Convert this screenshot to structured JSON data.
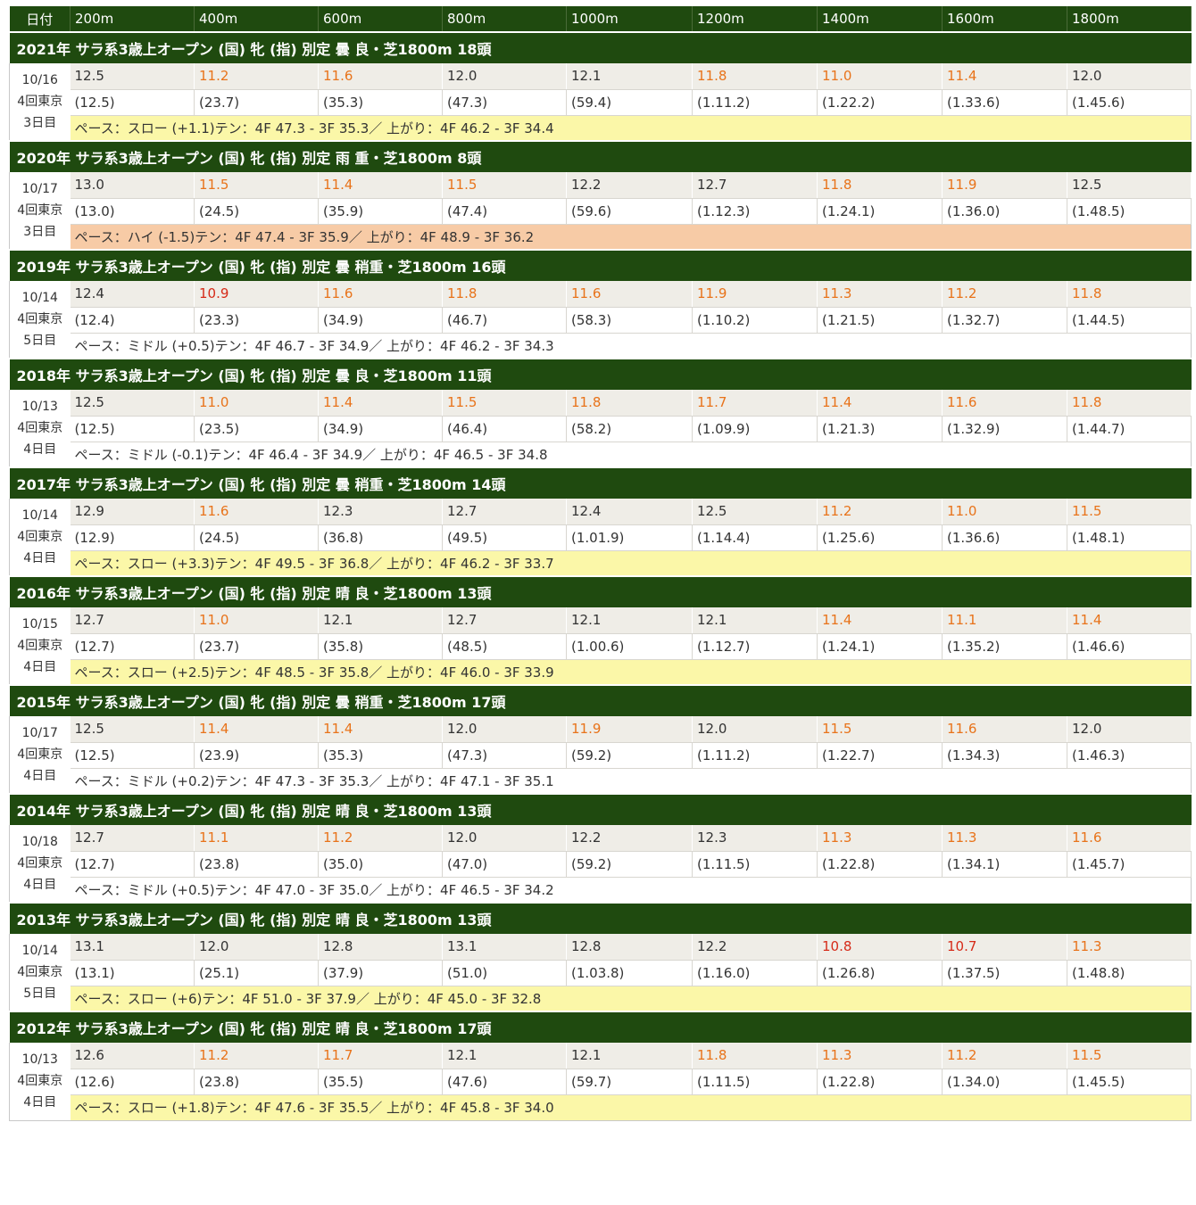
{
  "header": {
    "date_label": "日付",
    "distances": [
      "200m",
      "400m",
      "600m",
      "800m",
      "1000m",
      "1200m",
      "1400m",
      "1600m",
      "1800m"
    ]
  },
  "colors": {
    "header_bg": "#1f4a0f",
    "fast": "#e8731a",
    "very_fast": "#d62a18",
    "slow": "#fbf7a8",
    "high": "#f7cba6",
    "middle": "#acd86a"
  },
  "races": [
    {
      "title": "2021年  サラ系3歳上オープン (国) 牝 (指) 別定  曇 良・芝1800m   18頭",
      "date": "10/16",
      "meeting": "4回東京",
      "day": "3日目",
      "laps": [
        "12.5",
        "11.2",
        "11.6",
        "12.0",
        "12.1",
        "11.8",
        "11.0",
        "11.4",
        "12.0"
      ],
      "lap_marks": [
        "",
        "fast",
        "fast",
        "",
        "",
        "fast",
        "fast",
        "fast",
        ""
      ],
      "cumulative": [
        "(12.5)",
        "(23.7)",
        "(35.3)",
        "(47.3)",
        "(59.4)",
        "(1.11.2)",
        "(1.22.2)",
        "(1.33.6)",
        "(1.45.6)"
      ],
      "pace": "ペース：スロー (+1.1)テン：4F 47.3 - 3F 35.3／ 上がり：4F 46.2 - 3F 34.4",
      "pace_type": "slow"
    },
    {
      "title": "2020年  サラ系3歳上オープン (国) 牝 (指) 別定  雨 重・芝1800m   8頭",
      "date": "10/17",
      "meeting": "4回東京",
      "day": "3日目",
      "laps": [
        "13.0",
        "11.5",
        "11.4",
        "11.5",
        "12.2",
        "12.7",
        "11.8",
        "11.9",
        "12.5"
      ],
      "lap_marks": [
        "",
        "fast",
        "fast",
        "fast",
        "",
        "",
        "fast",
        "fast",
        ""
      ],
      "cumulative": [
        "(13.0)",
        "(24.5)",
        "(35.9)",
        "(47.4)",
        "(59.6)",
        "(1.12.3)",
        "(1.24.1)",
        "(1.36.0)",
        "(1.48.5)"
      ],
      "pace": "ペース：ハイ (-1.5)テン：4F 47.4 - 3F 35.9／ 上がり：4F 48.9 - 3F 36.2",
      "pace_type": "high"
    },
    {
      "title": "2019年  サラ系3歳上オープン (国) 牝 (指) 別定  曇 稍重・芝1800m   16頭",
      "date": "10/14",
      "meeting": "4回東京",
      "day": "5日目",
      "laps": [
        "12.4",
        "10.9",
        "11.6",
        "11.8",
        "11.6",
        "11.9",
        "11.3",
        "11.2",
        "11.8"
      ],
      "lap_marks": [
        "",
        "vfast",
        "fast",
        "fast",
        "fast",
        "fast",
        "fast",
        "fast",
        "fast"
      ],
      "cumulative": [
        "(12.4)",
        "(23.3)",
        "(34.9)",
        "(46.7)",
        "(58.3)",
        "(1.10.2)",
        "(1.21.5)",
        "(1.32.7)",
        "(1.44.5)"
      ],
      "pace": "ペース：ミドル (+0.5)テン：4F 46.7 - 3F 34.9／ 上がり：4F 46.2 - 3F 34.3",
      "pace_type": "middle"
    },
    {
      "title": "2018年  サラ系3歳上オープン (国) 牝 (指) 別定  曇 良・芝1800m   11頭",
      "date": "10/13",
      "meeting": "4回東京",
      "day": "4日目",
      "laps": [
        "12.5",
        "11.0",
        "11.4",
        "11.5",
        "11.8",
        "11.7",
        "11.4",
        "11.6",
        "11.8"
      ],
      "lap_marks": [
        "",
        "fast",
        "fast",
        "fast",
        "fast",
        "fast",
        "fast",
        "fast",
        "fast"
      ],
      "cumulative": [
        "(12.5)",
        "(23.5)",
        "(34.9)",
        "(46.4)",
        "(58.2)",
        "(1.09.9)",
        "(1.21.3)",
        "(1.32.9)",
        "(1.44.7)"
      ],
      "pace": "ペース：ミドル (-0.1)テン：4F 46.4 - 3F 34.9／ 上がり：4F 46.5 - 3F 34.8",
      "pace_type": "middle"
    },
    {
      "title": "2017年  サラ系3歳上オープン (国) 牝 (指) 別定  曇 稍重・芝1800m   14頭",
      "date": "10/14",
      "meeting": "4回東京",
      "day": "4日目",
      "laps": [
        "12.9",
        "11.6",
        "12.3",
        "12.7",
        "12.4",
        "12.5",
        "11.2",
        "11.0",
        "11.5"
      ],
      "lap_marks": [
        "",
        "fast",
        "",
        "",
        "",
        "",
        "fast",
        "fast",
        "fast"
      ],
      "cumulative": [
        "(12.9)",
        "(24.5)",
        "(36.8)",
        "(49.5)",
        "(1.01.9)",
        "(1.14.4)",
        "(1.25.6)",
        "(1.36.6)",
        "(1.48.1)"
      ],
      "pace": "ペース：スロー (+3.3)テン：4F 49.5 - 3F 36.8／ 上がり：4F 46.2 - 3F 33.7",
      "pace_type": "slow"
    },
    {
      "title": "2016年  サラ系3歳上オープン (国) 牝 (指) 別定  晴 良・芝1800m   13頭",
      "date": "10/15",
      "meeting": "4回東京",
      "day": "4日目",
      "laps": [
        "12.7",
        "11.0",
        "12.1",
        "12.7",
        "12.1",
        "12.1",
        "11.4",
        "11.1",
        "11.4"
      ],
      "lap_marks": [
        "",
        "fast",
        "",
        "",
        "",
        "",
        "fast",
        "fast",
        "fast"
      ],
      "cumulative": [
        "(12.7)",
        "(23.7)",
        "(35.8)",
        "(48.5)",
        "(1.00.6)",
        "(1.12.7)",
        "(1.24.1)",
        "(1.35.2)",
        "(1.46.6)"
      ],
      "pace": "ペース：スロー (+2.5)テン：4F 48.5 - 3F 35.8／ 上がり：4F 46.0 - 3F 33.9",
      "pace_type": "slow"
    },
    {
      "title": "2015年  サラ系3歳上オープン (国) 牝 (指) 別定  曇 稍重・芝1800m   17頭",
      "date": "10/17",
      "meeting": "4回東京",
      "day": "4日目",
      "laps": [
        "12.5",
        "11.4",
        "11.4",
        "12.0",
        "11.9",
        "12.0",
        "11.5",
        "11.6",
        "12.0"
      ],
      "lap_marks": [
        "",
        "fast",
        "fast",
        "",
        "fast",
        "",
        "fast",
        "fast",
        ""
      ],
      "cumulative": [
        "(12.5)",
        "(23.9)",
        "(35.3)",
        "(47.3)",
        "(59.2)",
        "(1.11.2)",
        "(1.22.7)",
        "(1.34.3)",
        "(1.46.3)"
      ],
      "pace": "ペース：ミドル (+0.2)テン：4F 47.3 - 3F 35.3／ 上がり：4F 47.1 - 3F 35.1",
      "pace_type": "middle"
    },
    {
      "title": "2014年  サラ系3歳上オープン (国) 牝 (指) 別定  晴 良・芝1800m   13頭",
      "date": "10/18",
      "meeting": "4回東京",
      "day": "4日目",
      "laps": [
        "12.7",
        "11.1",
        "11.2",
        "12.0",
        "12.2",
        "12.3",
        "11.3",
        "11.3",
        "11.6"
      ],
      "lap_marks": [
        "",
        "fast",
        "fast",
        "",
        "",
        "",
        "fast",
        "fast",
        "fast"
      ],
      "cumulative": [
        "(12.7)",
        "(23.8)",
        "(35.0)",
        "(47.0)",
        "(59.2)",
        "(1.11.5)",
        "(1.22.8)",
        "(1.34.1)",
        "(1.45.7)"
      ],
      "pace": "ペース：ミドル (+0.5)テン：4F 47.0 - 3F 35.0／ 上がり：4F 46.5 - 3F 34.2",
      "pace_type": "middle"
    },
    {
      "title": "2013年  サラ系3歳上オープン (国) 牝 (指) 別定  晴 良・芝1800m   13頭",
      "date": "10/14",
      "meeting": "4回東京",
      "day": "5日目",
      "laps": [
        "13.1",
        "12.0",
        "12.8",
        "13.1",
        "12.8",
        "12.2",
        "10.8",
        "10.7",
        "11.3"
      ],
      "lap_marks": [
        "",
        "",
        "",
        "",
        "",
        "",
        "vfast",
        "vfast",
        "fast"
      ],
      "cumulative": [
        "(13.1)",
        "(25.1)",
        "(37.9)",
        "(51.0)",
        "(1.03.8)",
        "(1.16.0)",
        "(1.26.8)",
        "(1.37.5)",
        "(1.48.8)"
      ],
      "pace": "ペース：スロー (+6)テン：4F 51.0 - 3F 37.9／ 上がり：4F 45.0 - 3F 32.8",
      "pace_type": "slow"
    },
    {
      "title": "2012年  サラ系3歳上オープン (国) 牝 (指) 別定  晴 良・芝1800m   17頭",
      "date": "10/13",
      "meeting": "4回東京",
      "day": "4日目",
      "laps": [
        "12.6",
        "11.2",
        "11.7",
        "12.1",
        "12.1",
        "11.8",
        "11.3",
        "11.2",
        "11.5"
      ],
      "lap_marks": [
        "",
        "fast",
        "fast",
        "",
        "",
        "fast",
        "fast",
        "fast",
        "fast"
      ],
      "cumulative": [
        "(12.6)",
        "(23.8)",
        "(35.5)",
        "(47.6)",
        "(59.7)",
        "(1.11.5)",
        "(1.22.8)",
        "(1.34.0)",
        "(1.45.5)"
      ],
      "pace": "ペース：スロー (+1.8)テン：4F 47.6 - 3F 35.5／ 上がり：4F 45.8 - 3F 34.0",
      "pace_type": "slow"
    }
  ]
}
